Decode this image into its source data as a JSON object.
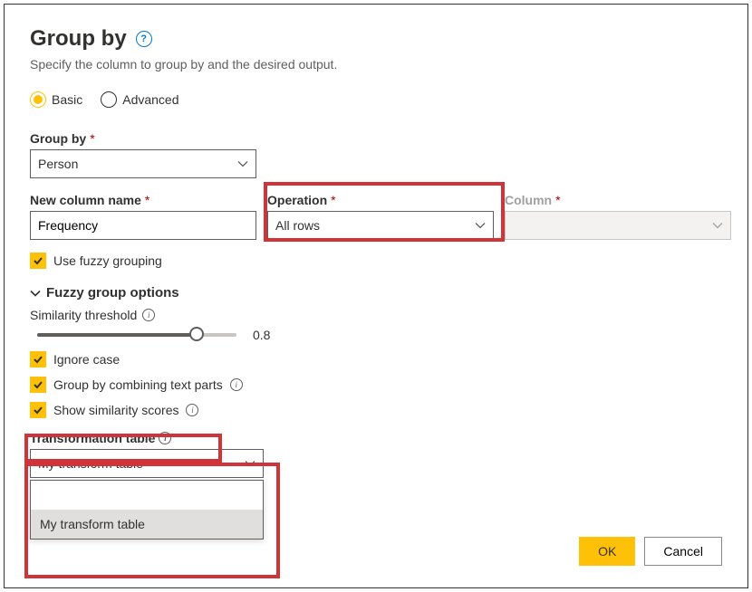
{
  "dialog": {
    "title": "Group by",
    "subtitle": "Specify the column to group by and the desired output."
  },
  "mode": {
    "basic": "Basic",
    "advanced": "Advanced",
    "selected": "basic"
  },
  "groupBy": {
    "label": "Group by",
    "value": "Person"
  },
  "newColumn": {
    "label": "New column name",
    "value": "Frequency"
  },
  "operation": {
    "label": "Operation",
    "value": "All rows"
  },
  "column": {
    "label": "Column",
    "value": ""
  },
  "fuzzy": {
    "use_label": "Use fuzzy grouping",
    "options_header": "Fuzzy group options",
    "threshold_label": "Similarity threshold",
    "threshold_value": "0.8",
    "ignore_case": "Ignore case",
    "combine_parts": "Group by combining text parts",
    "show_scores": "Show similarity scores",
    "transform_table_label": "Transformation table",
    "transform_table_value": "My transform table",
    "dropdown_option": "My transform table"
  },
  "buttons": {
    "ok": "OK",
    "cancel": "Cancel"
  }
}
